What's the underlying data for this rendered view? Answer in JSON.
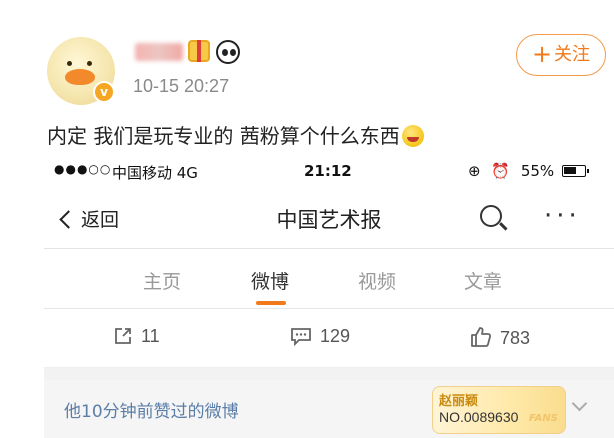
{
  "post": {
    "time": "10-15 20:27",
    "follow_label": "关注",
    "text": "内定 我们是玩专业的 茜粉算个什么东西"
  },
  "screenshot": {
    "status": {
      "carrier": "中国移动 4G",
      "time": "21:12",
      "battery": "55%"
    },
    "nav": {
      "back_label": "返回",
      "title": "中国艺术报"
    },
    "tabs": [
      {
        "label": "主页"
      },
      {
        "label": "微博"
      },
      {
        "label": "视频"
      },
      {
        "label": "文章"
      }
    ],
    "actions": {
      "share_count": "11",
      "comment_count": "129",
      "like_count": "783"
    },
    "liked_row": {
      "label": "他10分钟前赞过的微博",
      "fan_name": "赵丽颖",
      "fan_number": "NO.0089630",
      "fan_tag": "FANS"
    }
  },
  "colors": {
    "accent_orange": "#f27a1a",
    "link_blue": "#5b7ea8",
    "verified_gold": "#f5a623"
  }
}
